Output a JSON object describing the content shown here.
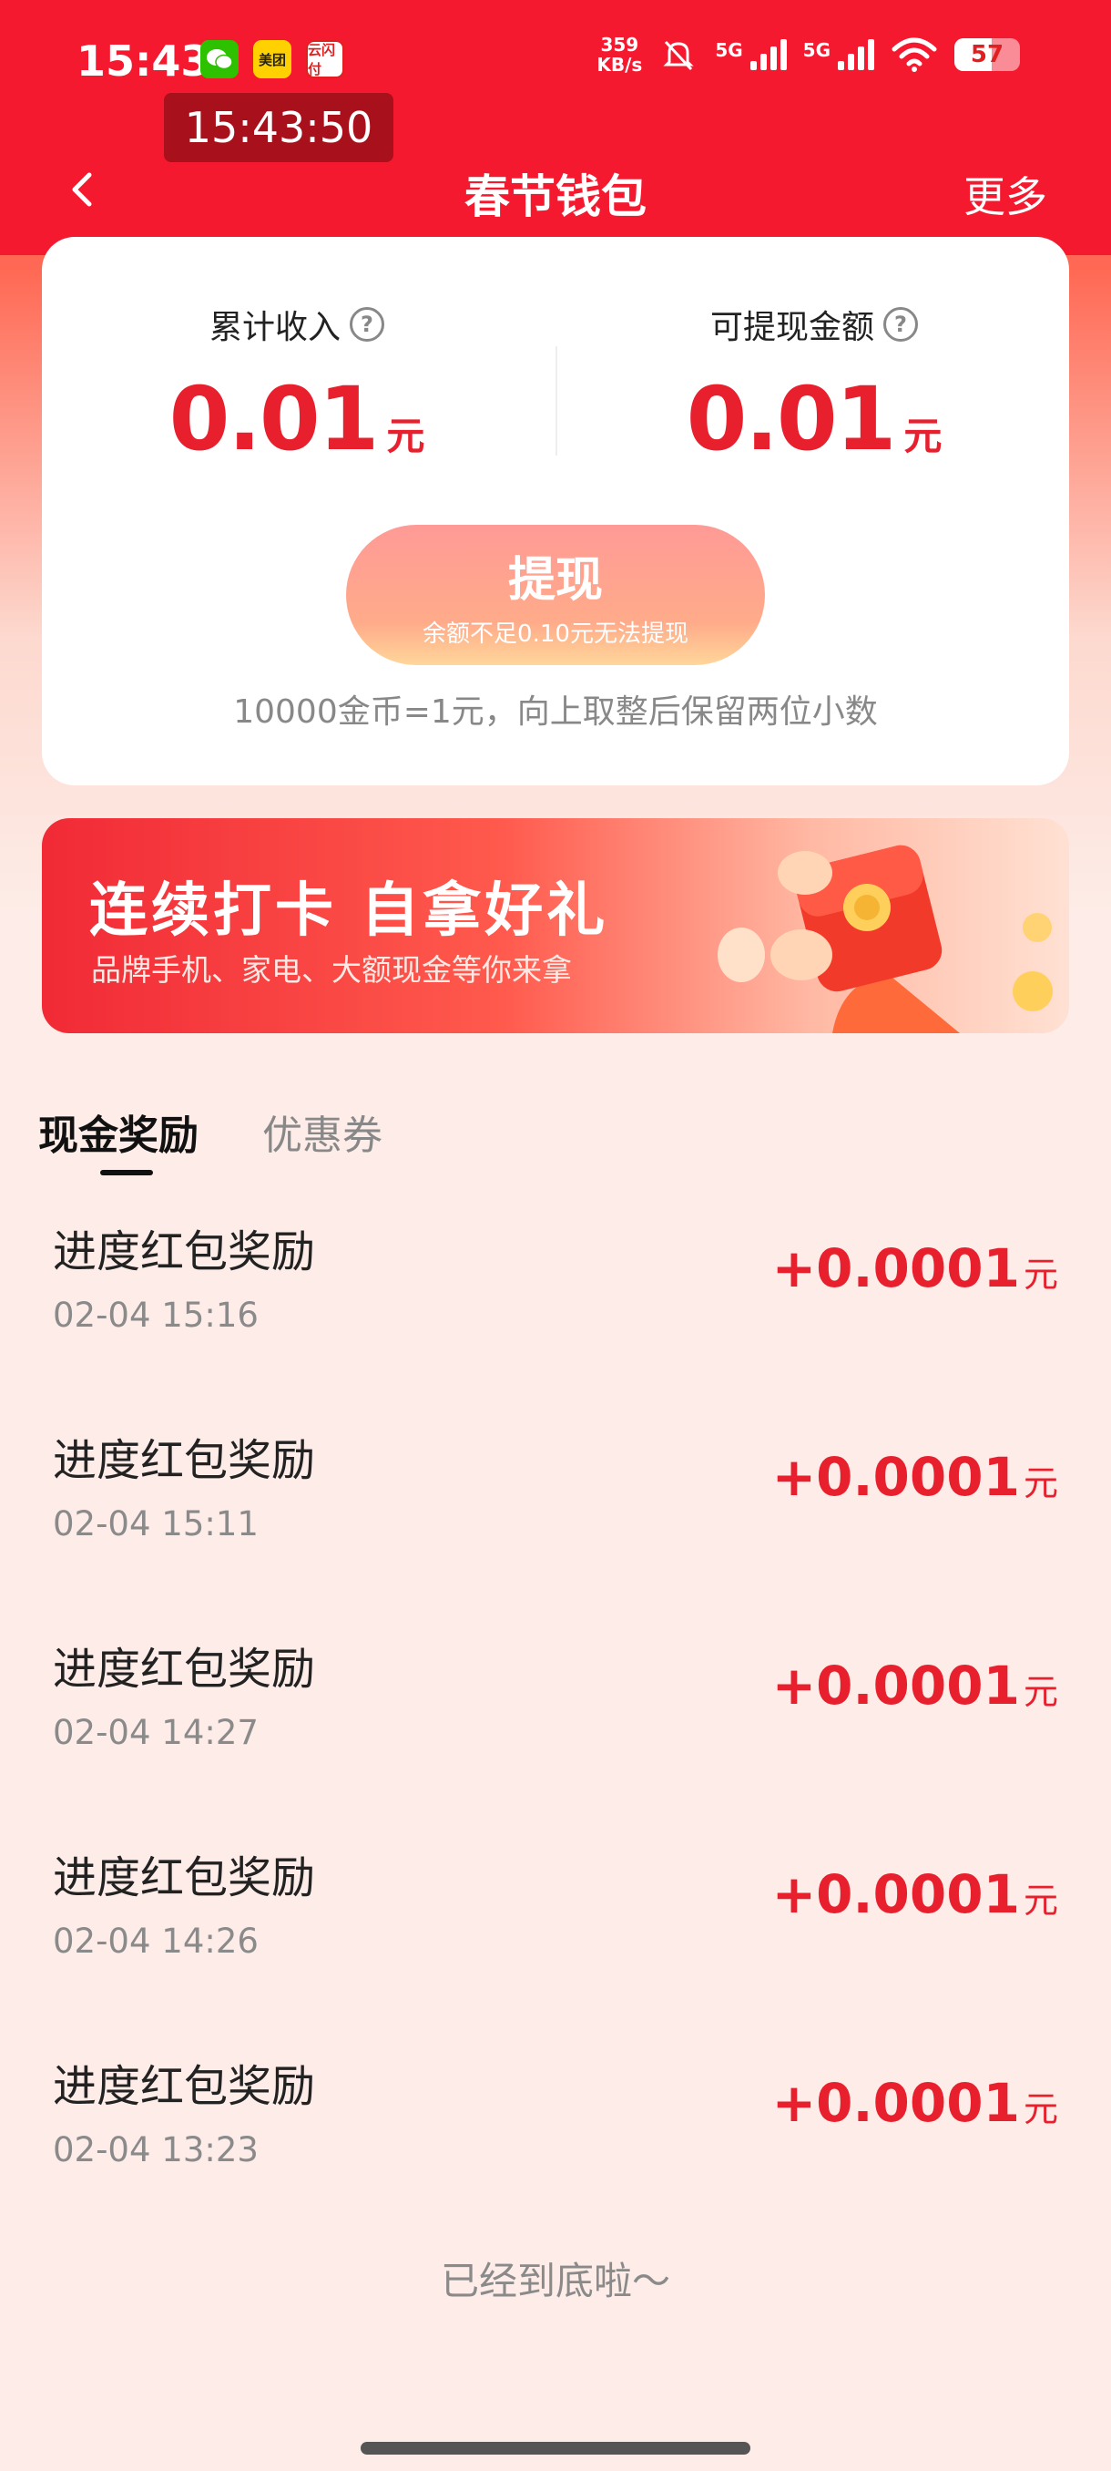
{
  "status_bar": {
    "time": "15:43",
    "apps": [
      {
        "name": "wechat",
        "label": ""
      },
      {
        "name": "meituan",
        "label": "美团"
      },
      {
        "name": "pay",
        "label": "云闪付"
      }
    ],
    "net_speed_value": "359",
    "net_speed_unit": "KB/s",
    "signal1_label": "5G",
    "signal2_label": "5G",
    "battery_level": "57",
    "battery_fraction": 0.57,
    "clock_overlay": "15:43:50"
  },
  "header": {
    "back_icon": "chevron-left-icon",
    "title": "春节钱包",
    "more_label": "更多"
  },
  "balance_card": {
    "total_income_label": "累计收入",
    "total_income_value": "0.01",
    "total_income_unit": "元",
    "withdrawable_label": "可提现金额",
    "withdrawable_value": "0.01",
    "withdrawable_unit": "元",
    "help_glyph": "?",
    "withdraw_button_label": "提现",
    "withdraw_button_sub": "余额不足0.10元无法提现",
    "rate_note": "10000金币=1元，向上取整后保留两位小数"
  },
  "banner": {
    "title": "连续打卡 自拿好礼",
    "subtitle": "品牌手机、家电、大额现金等你来拿"
  },
  "tabs": {
    "cash": "现金奖励",
    "coupon": "优惠券",
    "active": "cash"
  },
  "rewards": [
    {
      "title": "进度红包奖励",
      "time": "02-04 15:16",
      "amount": "+0.0001",
      "unit": "元"
    },
    {
      "title": "进度红包奖励",
      "time": "02-04 15:11",
      "amount": "+0.0001",
      "unit": "元"
    },
    {
      "title": "进度红包奖励",
      "time": "02-04 14:27",
      "amount": "+0.0001",
      "unit": "元"
    },
    {
      "title": "进度红包奖励",
      "time": "02-04 14:26",
      "amount": "+0.0001",
      "unit": "元"
    },
    {
      "title": "进度红包奖励",
      "time": "02-04 13:23",
      "amount": "+0.0001",
      "unit": "元"
    }
  ],
  "end_note": "已经到底啦～",
  "colors": {
    "brand_red": "#f5192f",
    "amount_red": "#e8202e",
    "page_bg": "#fdece7"
  }
}
